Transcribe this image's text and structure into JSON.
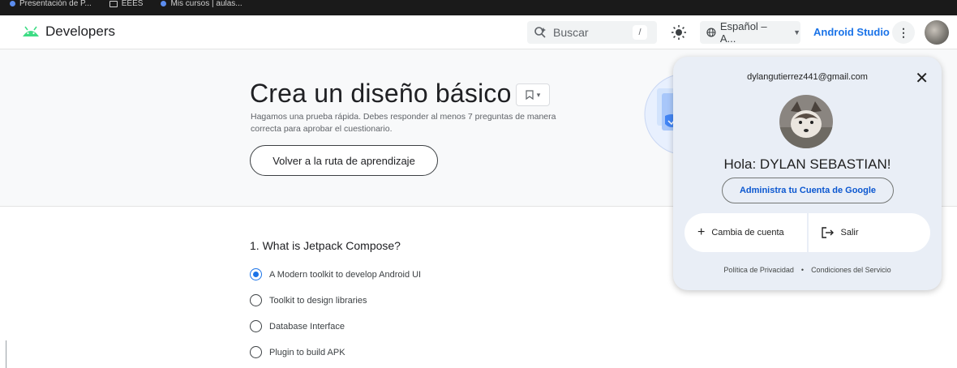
{
  "bookmarks": [
    {
      "label": "Presentación de P..."
    },
    {
      "label": "EEES"
    },
    {
      "label": "Mis cursos | aulas..."
    }
  ],
  "header": {
    "logo_text": "Developers",
    "search_placeholder": "Buscar",
    "search_shortcut": "/",
    "language": "Español – A...",
    "studio_link": "Android Studio",
    "more_icon": "⋮"
  },
  "hero": {
    "title": "Crea un diseño básico",
    "description": "Hagamos una prueba rápida. Debes responder al menos 7 preguntas de manera correcta para aprobar el cuestionario.",
    "back_button": "Volver a la ruta de aprendizaje"
  },
  "quiz": {
    "question": "1. What is Jetpack Compose?",
    "options": [
      {
        "label": "A Modern toolkit to develop Android UI",
        "selected": true
      },
      {
        "label": "Toolkit to design libraries",
        "selected": false
      },
      {
        "label": "Database Interface",
        "selected": false
      },
      {
        "label": "Plugin to build APK",
        "selected": false
      }
    ]
  },
  "account": {
    "email": "dylangutierrez441@gmail.com",
    "greeting": "Hola: DYLAN SEBASTIAN!",
    "manage_button": "Administra tu Cuenta de Google",
    "switch_account": "Cambia de cuenta",
    "sign_out": "Salir",
    "privacy": "Política de Privacidad",
    "separator": "•",
    "terms": "Condiciones del Servicio"
  },
  "colors": {
    "accent": "#1a73e8",
    "android_green": "#3ddc84",
    "popup_bg": "#e9eef6"
  }
}
